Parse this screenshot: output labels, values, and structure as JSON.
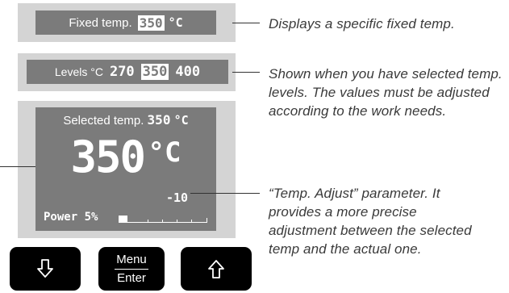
{
  "fixed_display": {
    "label": "Fixed temp.",
    "value": "350",
    "unit": "°C"
  },
  "levels_display": {
    "label": "Levels °C",
    "levels": [
      "270",
      "350",
      "400"
    ],
    "selected_index": 1
  },
  "main_display": {
    "selected_label": "Selected temp.",
    "selected_value": "350",
    "selected_unit": "°C",
    "big_temp": "350",
    "big_unit": "°C",
    "adjust_value": "-10",
    "power_label": "Power 5%",
    "power_fraction": 0.05
  },
  "buttons": {
    "down_icon": "arrow-down-icon",
    "menu_label": "Menu",
    "enter_label": "Enter",
    "up_icon": "arrow-up-icon"
  },
  "callouts": {
    "fixed": "Displays a specific fixed temp.",
    "levels": "Shown when you have selected temp. levels. The values must be adjusted according to the work needs.",
    "adjust": "“Temp. Adjust” parameter. It provides a more precise adjustment between the selected temp and the actual one."
  },
  "colors": {
    "screen": "#7b7b7b",
    "frame": "#d4d4d4",
    "button": "#000000",
    "text": "#3a3a3a"
  }
}
